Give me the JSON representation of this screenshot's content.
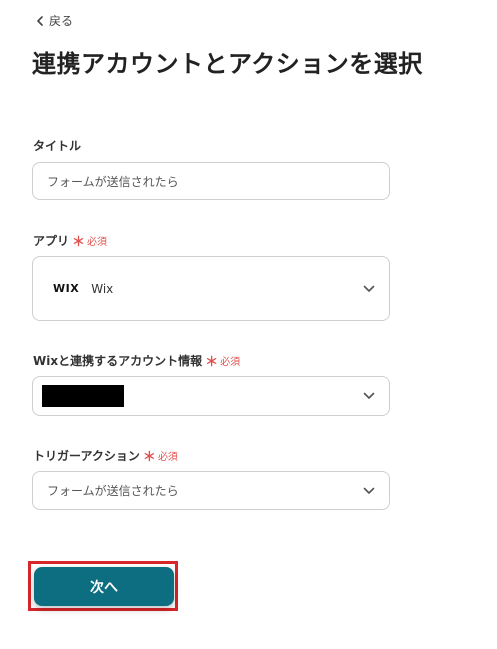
{
  "nav": {
    "back_label": "戻る"
  },
  "page": {
    "title": "連携アカウントとアクションを選択"
  },
  "fields": {
    "title": {
      "label": "タイトル",
      "value": "フォームが送信されたら"
    },
    "app": {
      "label": "アプリ",
      "required_mark": "＊",
      "required_text": "必須",
      "logo_text": "WIX",
      "value": "Wix"
    },
    "account": {
      "label": "Wixと連携するアカウント情報",
      "required_mark": "＊",
      "required_text": "必須"
    },
    "trigger": {
      "label": "トリガーアクション",
      "required_mark": "＊",
      "required_text": "必須",
      "value": "フォームが送信されたら"
    }
  },
  "actions": {
    "next_label": "次へ"
  },
  "colors": {
    "primary": "#0d6e82",
    "required": "#e0524f",
    "highlight": "#d9262a",
    "border": "#cfcfcf"
  }
}
